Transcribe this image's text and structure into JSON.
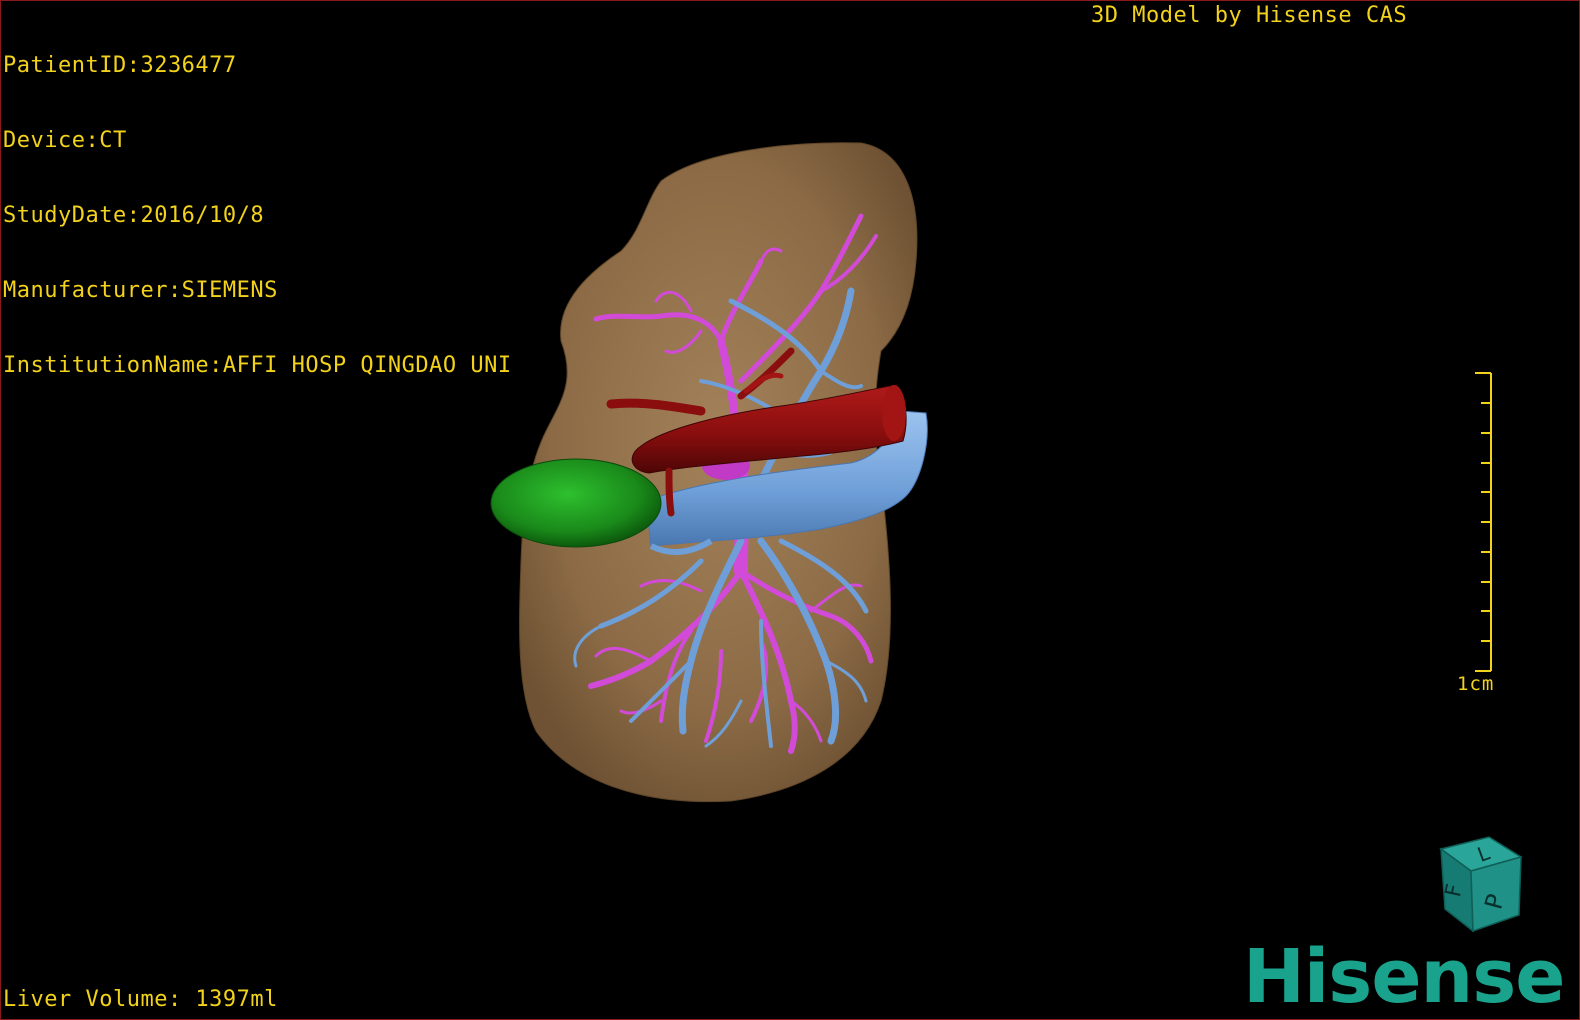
{
  "overlay": {
    "patient_id": "PatientID:3236477",
    "device": "Device:CT",
    "study_date": "StudyDate:2016/10/8",
    "manufacturer": "Manufacturer:SIEMENS",
    "institution": "InstitutionName:AFFI HOSP QINGDAO UNI",
    "model_credit": "3D Model by Hisense CAS",
    "liver_volume": "Liver Volume: 1397ml"
  },
  "scale": {
    "label": "1cm"
  },
  "orientation_cube": {
    "faces": [
      "F",
      "L",
      "P"
    ]
  },
  "logo": {
    "text": "Hisense"
  },
  "colors": {
    "overlay_text": "#f2d21b",
    "liver": "#8b6a45",
    "artery": "#8a0e0e",
    "portal_vein": "#6f9fd8",
    "hepatic_vein": "#d24ad8",
    "gallbladder": "#1a8a1a",
    "brand": "#1aa38c"
  },
  "structures": [
    "liver-surface",
    "hepatic-artery",
    "portal-vein",
    "hepatic-vein",
    "gallbladder"
  ]
}
